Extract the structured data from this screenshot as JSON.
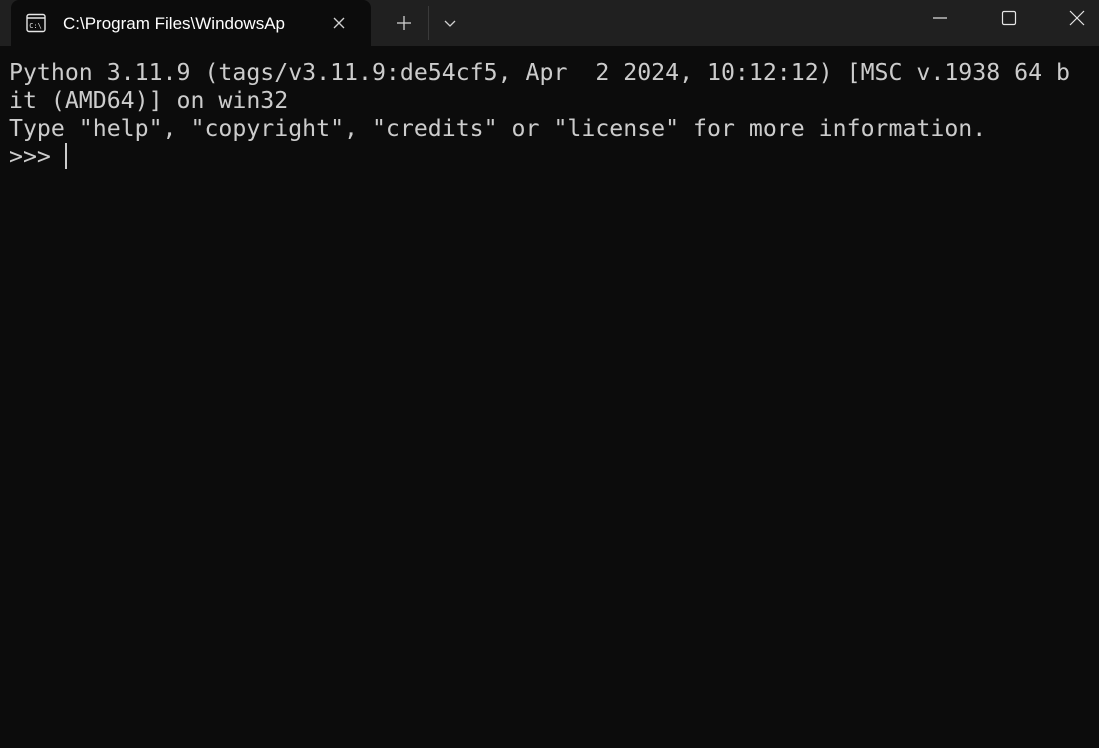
{
  "window": {
    "tab_title": "C:\\Program Files\\WindowsAp",
    "tab_icon": "console-icon",
    "close_tab_icon": "close-icon",
    "new_tab_icon": "plus-icon",
    "dropdown_icon": "chevron-down-icon",
    "minimize_icon": "minimize-icon",
    "maximize_icon": "maximize-icon",
    "close_window_icon": "close-icon"
  },
  "terminal": {
    "lines": [
      "Python 3.11.9 (tags/v3.11.9:de54cf5, Apr  2 2024, 10:12:12) [MSC v.1938 64 b",
      "it (AMD64)] on win32",
      "Type \"help\", \"copyright\", \"credits\" or \"license\" for more information."
    ],
    "prompt": ">>> "
  },
  "colors": {
    "terminal_background": "#0c0c0c",
    "titlebar_background": "#202020",
    "text": "#cccccc",
    "tab_text": "#ffffff"
  }
}
